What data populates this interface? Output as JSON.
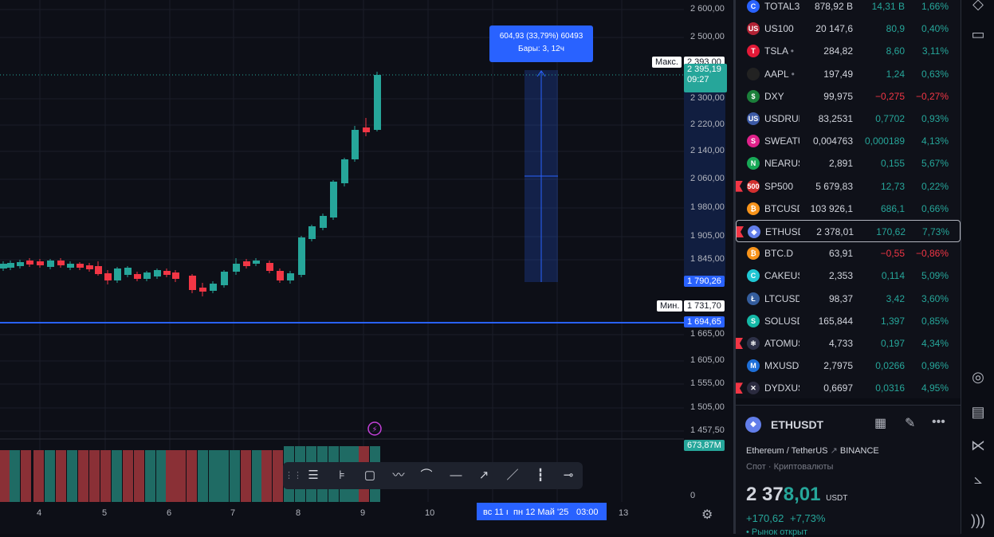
{
  "chart": {
    "price_axis": [
      "2 600,00",
      "2 500,00",
      "2 300,00",
      "2 220,00",
      "2 140,00",
      "2 060,00",
      "1 980,00",
      "1 905,00",
      "1 845,00",
      "1 665,00",
      "1 605,00",
      "1 555,00",
      "1 505,00",
      "1 457,50",
      "0"
    ],
    "price_tags": {
      "max_label": "Макс.",
      "max_value": "2 393,00",
      "current_value": "2 395,19",
      "current_time": "09:27",
      "range_low": "1 790,26",
      "min_label": "Мин.",
      "min_value": "1 731,70",
      "hline_value": "1 694,65",
      "volume_value": "673,87M"
    },
    "measure": {
      "line1": "604,93 (33,79%) 60493",
      "line2": "Бары: 3, 12ч"
    },
    "x_axis": [
      "4",
      "5",
      "6",
      "7",
      "8",
      "9",
      "10",
      "13"
    ],
    "x_highlight": {
      "date1": "вс 11 ı",
      "date2": "пн 12 Май '25",
      "time": "03:00"
    },
    "colors": {
      "up": "#26a69a",
      "down": "#f23645",
      "accent": "#2962ff"
    }
  },
  "drawing_toolbar": {
    "icons": [
      "drag-handle-icon",
      "lines-icon",
      "fib-icon",
      "rectangle-icon",
      "path-icon",
      "curve-icon",
      "horizontal-line-icon",
      "ray-icon",
      "trend-line-icon",
      "candles-icon",
      "dash-line-icon"
    ]
  },
  "watchlist": [
    {
      "sym": "TOTAL3",
      "last": "878,92 B",
      "chg": "14,31 B",
      "pct": "1,66%",
      "dir": "down-last",
      "icon": "C",
      "color": "#2962ff",
      "flag": false
    },
    {
      "sym": "US100",
      "last": "20 147,6",
      "chg": "80,9",
      "pct": "0,40%",
      "dir": "down-last",
      "icon": "US",
      "color": "#b22234",
      "flag": false
    },
    {
      "sym": "TSLA",
      "last": "284,82",
      "chg": "8,60",
      "pct": "3,11%",
      "dir": "up",
      "icon": "T",
      "color": "#e31937",
      "flag": false,
      "dot": true
    },
    {
      "sym": "AAPL",
      "last": "197,49",
      "chg": "1,24",
      "pct": "0,63%",
      "dir": "up",
      "icon": "",
      "color": "#222",
      "flag": false,
      "dot": true
    },
    {
      "sym": "DXY",
      "last": "99,975",
      "chg": "−0,275",
      "pct": "−0,27%",
      "dir": "down",
      "icon": "$",
      "color": "#1b7f3a",
      "flag": false
    },
    {
      "sym": "USDRUB",
      "last": "83,2531",
      "chg": "0,7702",
      "pct": "0,93%",
      "dir": "up",
      "icon": "US",
      "color": "#3c5aa6",
      "flag": false
    },
    {
      "sym": "SWEATUSDT",
      "last": "0,004763",
      "chg": "0,000189",
      "pct": "4,13%",
      "dir": "up",
      "icon": "S",
      "color": "#e0218a",
      "flag": false
    },
    {
      "sym": "NEARUSDT",
      "last": "2,891",
      "chg": "0,155",
      "pct": "5,67%",
      "dir": "up",
      "icon": "N",
      "color": "#18a957",
      "flag": false
    },
    {
      "sym": "SP500",
      "last": "5 679,83",
      "chg": "12,73",
      "pct": "0,22%",
      "dir": "up",
      "icon": "500",
      "color": "#d32f2f",
      "flag": true
    },
    {
      "sym": "BTCUSDT",
      "last": "103 926,1",
      "chg": "686,1",
      "pct": "0,66%",
      "dir": "up",
      "icon": "₿",
      "color": "#f7931a",
      "flag": false
    },
    {
      "sym": "ETHUSDT",
      "last": "2 378,01",
      "chg": "170,62",
      "pct": "7,73%",
      "dir": "up",
      "icon": "◆",
      "color": "#627eea",
      "flag": true,
      "selected": true
    },
    {
      "sym": "BTC.D",
      "last": "63,91",
      "chg": "−0,55",
      "pct": "−0,86%",
      "dir": "down",
      "icon": "₿",
      "color": "#f7931a",
      "flag": false
    },
    {
      "sym": "CAKEUSDT",
      "last": "2,353",
      "chg": "0,114",
      "pct": "5,09%",
      "dir": "up",
      "icon": "C",
      "color": "#1fc7d4",
      "flag": false
    },
    {
      "sym": "LTCUSDT",
      "last": "98,37",
      "chg": "3,42",
      "pct": "3,60%",
      "dir": "up",
      "icon": "Ł",
      "color": "#345d9d",
      "flag": false
    },
    {
      "sym": "SOLUSDT",
      "last": "165,844",
      "chg": "1,397",
      "pct": "0,85%",
      "dir": "up",
      "icon": "S",
      "color": "#14b8a6",
      "flag": false
    },
    {
      "sym": "ATOMUSDT",
      "last": "4,733",
      "chg": "0,197",
      "pct": "4,34%",
      "dir": "up",
      "icon": "⚛",
      "color": "#2e3148",
      "flag": true
    },
    {
      "sym": "MXUSDT",
      "last": "2,7975",
      "chg": "0,0266",
      "pct": "0,96%",
      "dir": "up",
      "icon": "M",
      "color": "#1e6fd9",
      "flag": false
    },
    {
      "sym": "DYDXUSDT",
      "last": "0,6697",
      "chg": "0,0316",
      "pct": "4,95%",
      "dir": "up",
      "icon": "✕",
      "color": "#2b2b3f",
      "flag": true
    }
  ],
  "details": {
    "symbol": "ETHUSDT",
    "name": "Ethereum / TetherUS",
    "exchange": "BINANCE",
    "category": "Спот · Криптовалюты",
    "price_main": "2 37",
    "price_tail": "8,01",
    "currency": "USDT",
    "change": "+170,62",
    "change_pct": "+7,73%",
    "extra": "• Рынок открыт"
  }
}
